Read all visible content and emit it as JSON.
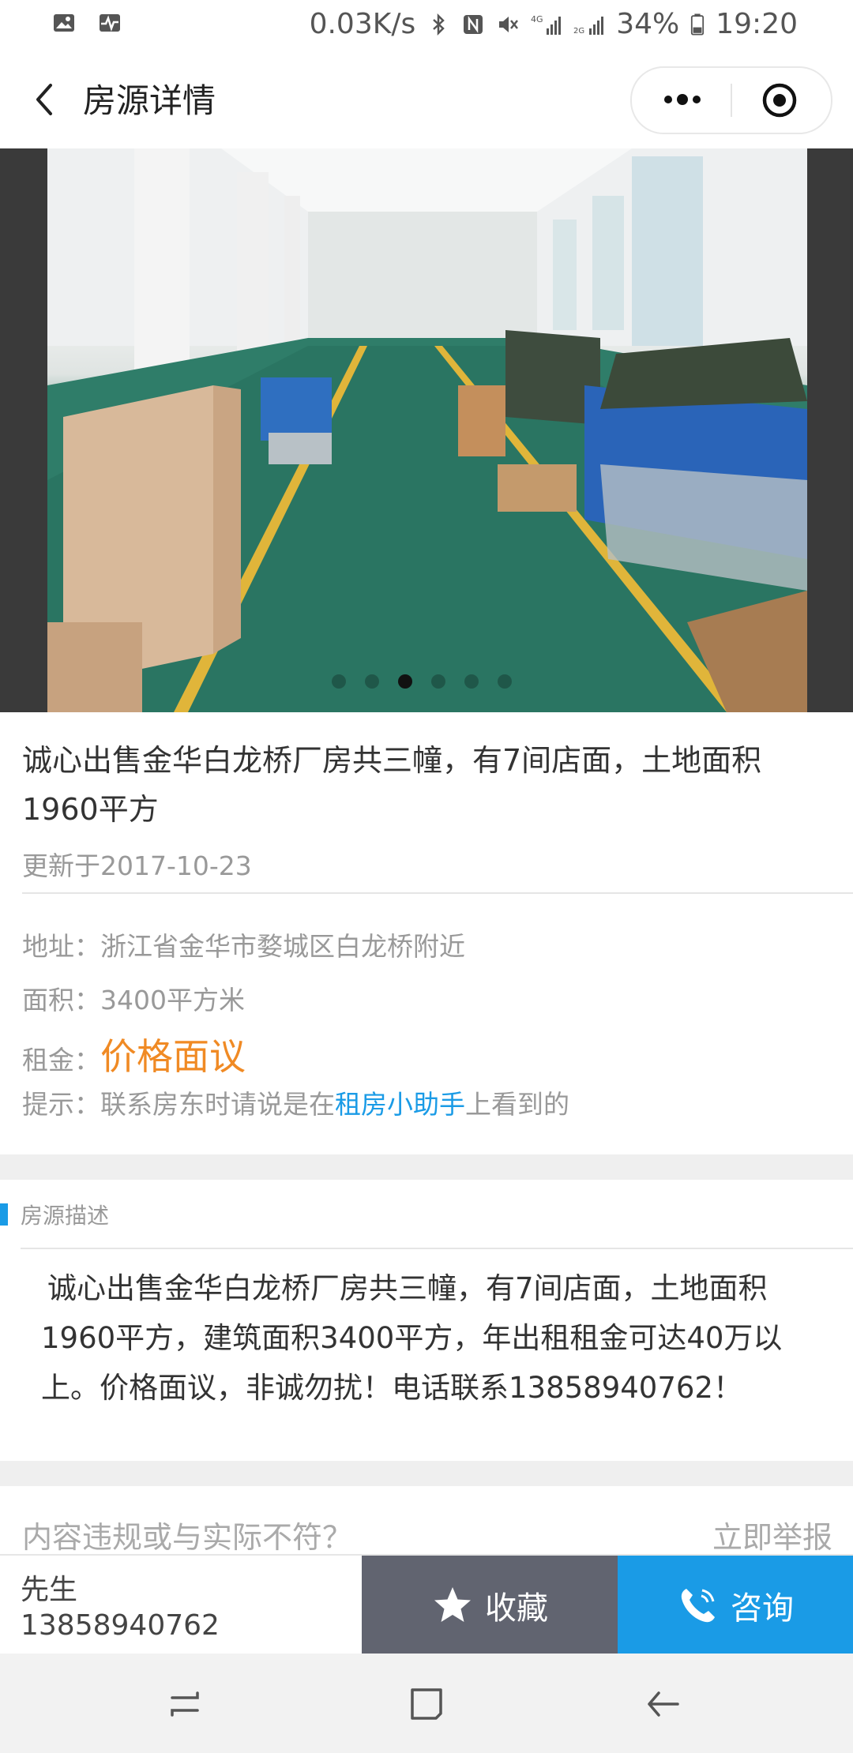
{
  "status_bar": {
    "network_speed": "0.03K/s",
    "battery": "34%",
    "time": "19:20",
    "icons": [
      "image-icon",
      "activity-icon",
      "bluetooth-icon",
      "nfc-icon",
      "mute-icon",
      "4g-signal-icon",
      "2g-signal-icon",
      "battery-icon"
    ]
  },
  "header": {
    "title": "房源详情",
    "icons": [
      "back-arrow-icon",
      "more-dots-icon",
      "target-circle-icon"
    ]
  },
  "carousel": {
    "slide_count": 6,
    "active_index": 2
  },
  "listing": {
    "headline": "诚心出售金华白龙桥厂房共三幢，有7间店面，土地面积1960平方",
    "updated": "更新于2017-10-23",
    "address_label": "地址：",
    "address": "浙江省金华市婺城区白龙桥附近",
    "area_label": "面积：",
    "area": "3400平方米",
    "rent_label": "租金：",
    "rent": "价格面议",
    "tip_prefix": "提示：联系房东时请说是在",
    "tip_link": "租房小助手",
    "tip_suffix": "上看到的"
  },
  "description": {
    "section_title": "房源描述",
    "body": "诚心出售金华白龙桥厂房共三幢，有7间店面，土地面积1960平方，建筑面积3400平方，年出租租金可达40万以上。价格面议，非诚勿扰！电话联系13858940762！"
  },
  "report": {
    "question": "内容违规或与实际不符？",
    "action": "立即举报"
  },
  "action_bar": {
    "contact_name": "先生",
    "contact_phone": "13858940762",
    "favorite_label": "收藏",
    "consult_label": "咨询"
  },
  "colors": {
    "accent_blue": "#1a9be6",
    "price_orange": "#f08a24",
    "favorite_gray": "#616470"
  }
}
